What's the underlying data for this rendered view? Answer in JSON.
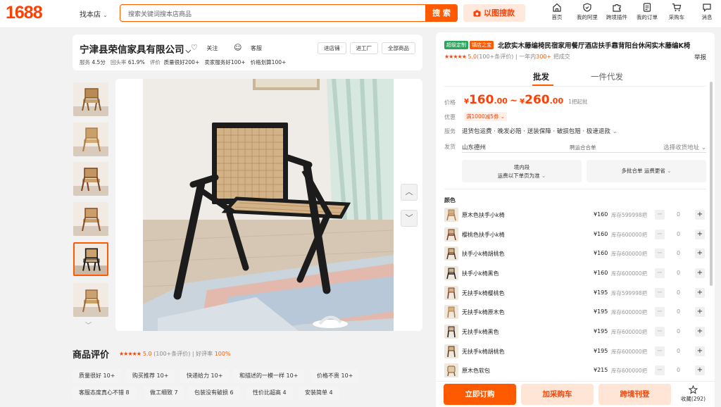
{
  "header": {
    "logo": "1688",
    "scope_label": "找本店",
    "search_placeholder": "搜索关键词搜本店商品",
    "search_button": "搜 索",
    "image_search": "以图搜款",
    "nav": [
      {
        "label": "首页",
        "icon": "home-icon"
      },
      {
        "label": "我的阿里",
        "icon": "user-shield-icon"
      },
      {
        "label": "跨境插件",
        "icon": "puzzle-icon"
      },
      {
        "label": "我的订单",
        "icon": "order-icon"
      },
      {
        "label": "采购车",
        "icon": "cart-icon"
      },
      {
        "label": "消息",
        "icon": "message-icon"
      }
    ]
  },
  "shop": {
    "name": "宁津县荣信家具有限公司",
    "follow": "关注",
    "service": "客服",
    "meta": {
      "service_label": "服务",
      "service_score": "4.5分",
      "repurchase_label": "回头率",
      "repurchase": "61.9%",
      "eval_label": "评价",
      "quality": "质量很好200+",
      "seller_service": "卖家服务好100+",
      "value": "价格划算100+"
    },
    "buttons": [
      "进店铺",
      "进工厂",
      "全部商品"
    ]
  },
  "reviews": {
    "title": "商品评价",
    "score": "5.0",
    "count": "(100+条评价)",
    "good_label": "好评率",
    "good_rate": "100%",
    "tags": [
      "质量很好 10+",
      "购买推荐 10+",
      "快递给力 10+",
      "和描述的一模一样 10+",
      "价格不贵 10+",
      "客服态度真心不错 8",
      "做工细致 7",
      "包装没有破损 6",
      "性价比超高 4",
      "安装简单 4"
    ]
  },
  "product": {
    "badges": [
      {
        "text": "超级定制",
        "color": "#2ca55e"
      },
      {
        "text": "镇店之宝",
        "color": "#ff5a00"
      }
    ],
    "title": "北欧实木藤编椅民宿家用餐厅酒店扶手靠背阳台休闲实木藤编K椅",
    "rating": "5.0",
    "rating_count": "(100+条评价)",
    "sales_prefix": "一年内",
    "sales_count": "300+",
    "sales_suffix": "把成交",
    "report": "举报",
    "tabs": [
      "批发",
      "一件代发"
    ],
    "price_label": "价格",
    "price_low_int": "160",
    "price_low_dec": ".00",
    "price_high_int": "260",
    "price_high_dec": ".00",
    "price_tilde": "~",
    "currency": "¥",
    "min_order": "1把起批",
    "promo_label": "优惠",
    "promo": "满1000减5券",
    "service_label": "服务",
    "services": "退货包运费 · 晚发必赔 · 送装保障 · 破损包赔 · 极速退款",
    "ship_label": "发货",
    "ship_from": "山东德州",
    "ship_mid": "聘运合合单",
    "ship_addr": "选择收货地址",
    "ship_box1_title": "境内段",
    "ship_box1_sub": "运费以下单页为准",
    "ship_box2": "多批合单 运费更省",
    "color_label": "颜色"
  },
  "skus": [
    {
      "name": "原木色扶手小k椅",
      "price": "¥160",
      "stock": "库存599998把",
      "qty": "0"
    },
    {
      "name": "樱桃色扶手小k椅",
      "price": "¥160",
      "stock": "库存600000把",
      "qty": "0"
    },
    {
      "name": "扶手小k椅胡桃色",
      "price": "¥160",
      "stock": "库存600000把",
      "qty": "0"
    },
    {
      "name": "扶手小k椅黑色",
      "price": "¥160",
      "stock": "库存600000把",
      "qty": "0"
    },
    {
      "name": "无扶手k椅樱桃色",
      "price": "¥195",
      "stock": "库存599998把",
      "qty": "0"
    },
    {
      "name": "无扶手k椅原木色",
      "price": "¥195",
      "stock": "库存600000把",
      "qty": "0"
    },
    {
      "name": "无扶手k椅黑色",
      "price": "¥195",
      "stock": "库存600000把",
      "qty": "0"
    },
    {
      "name": "无扶手k椅胡桃色",
      "price": "¥195",
      "stock": "库存600000把",
      "qty": "0"
    },
    {
      "name": "原木色软包",
      "price": "¥215",
      "stock": "库存600000把",
      "qty": "0"
    }
  ],
  "actions": {
    "buy": "立即订购",
    "cart": "加采购车",
    "cross": "跨境刊登",
    "fav": "收藏(292)"
  }
}
